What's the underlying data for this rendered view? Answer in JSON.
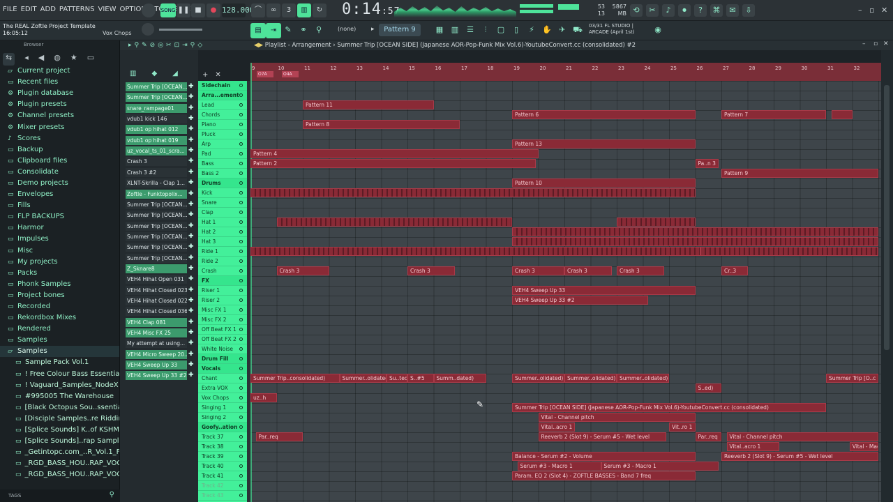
{
  "menu": [
    "FILE",
    "EDIT",
    "ADD",
    "PATTERNS",
    "VIEW",
    "OPTIONS",
    "TOOLS",
    "HELP"
  ],
  "transport": {
    "bpm": "128.000",
    "time_main": "0:14",
    "time_sub": ":57",
    "mode_label": "SONG",
    "cpu": "53",
    "voices": "13",
    "mem": "5867 MB"
  },
  "project": {
    "title": "The REAL Zoftle Project Template",
    "time": "16:05:12",
    "hint": "Vox Chops"
  },
  "toolbar": {
    "snap": "(none)",
    "pattern": "Pattern 9"
  },
  "news": {
    "line1": "03/31  FL STUDIO |",
    "line2": "ARCADE (April 1st)"
  },
  "browser": {
    "label": "Browser",
    "items": [
      {
        "label": "Current project",
        "icon": "folder-open"
      },
      {
        "label": "Recent files",
        "icon": "folder"
      },
      {
        "label": "Plugin database",
        "icon": "plug"
      },
      {
        "label": "Plugin presets",
        "icon": "plug"
      },
      {
        "label": "Channel presets",
        "icon": "plug"
      },
      {
        "label": "Mixer presets",
        "icon": "plug"
      },
      {
        "label": "Scores",
        "icon": "note"
      },
      {
        "label": "Backup",
        "icon": "folder"
      },
      {
        "label": "Clipboard files",
        "icon": "folder"
      },
      {
        "label": "Consolidate",
        "icon": "folder"
      },
      {
        "label": "Demo projects",
        "icon": "folder"
      },
      {
        "label": "Envelopes",
        "icon": "folder"
      },
      {
        "label": "Fills",
        "icon": "folder"
      },
      {
        "label": "FLP BACKUPS",
        "icon": "folder"
      },
      {
        "label": "Harmor",
        "icon": "folder"
      },
      {
        "label": "Impulses",
        "icon": "folder"
      },
      {
        "label": "Misc",
        "icon": "folder"
      },
      {
        "label": "My projects",
        "icon": "folder"
      },
      {
        "label": "Packs",
        "icon": "folder"
      },
      {
        "label": "Phonk Samples",
        "icon": "folder"
      },
      {
        "label": "Project bones",
        "icon": "folder"
      },
      {
        "label": "Recorded",
        "icon": "folder"
      },
      {
        "label": "Rekordbox Mixes",
        "icon": "folder"
      },
      {
        "label": "Rendered",
        "icon": "folder"
      },
      {
        "label": "Samples",
        "icon": "folder"
      },
      {
        "label": "Samples",
        "icon": "folder-open",
        "selected": true
      },
      {
        "label": "Sample Pack Vol.1",
        "icon": "folder",
        "sub": true
      },
      {
        "label": "! Free Colour Bass Essentials !",
        "icon": "folder",
        "sub": true
      },
      {
        "label": "! Vaguard_Samples_NodeX !",
        "icon": "folder",
        "sub": true
      },
      {
        "label": "#995005 The Warehouse",
        "icon": "folder",
        "sub": true
      },
      {
        "label": "[Black Octopus Sou..ssentials Vol. 1",
        "icon": "folder",
        "sub": true
      },
      {
        "label": "[Disciple Samples..re Riddim Vol. 1",
        "icon": "folder",
        "sub": true
      },
      {
        "label": "[Splice Sounds] K..of KSHMR Vol. 3",
        "icon": "folder",
        "sub": true
      },
      {
        "label": "[Splice Sounds]..rap Samples Vol. 1",
        "icon": "folder",
        "sub": true
      },
      {
        "label": "_Getintopc.com_..R_Vol.1_FXB_WAV",
        "icon": "folder",
        "sub": true
      },
      {
        "label": "_RGD_BASS_HOU..RAP_VOCALS_V1",
        "icon": "folder",
        "sub": true
      },
      {
        "label": "_RGD_BASS_HOU..RAP_VOCALS_V2",
        "icon": "folder",
        "sub": true
      }
    ],
    "tags_label": "TAGS"
  },
  "channels": [
    {
      "label": "Summer Trip [OCEAN...",
      "dark": false
    },
    {
      "label": "Summer Trip [OCEAN...",
      "dark": false
    },
    {
      "label": "snare_rampage01",
      "dark": false
    },
    {
      "label": "vdub1 kick 146",
      "dark": true
    },
    {
      "label": "vdub1 op hihat 012",
      "dark": false
    },
    {
      "label": "vdub1 op hihat 019",
      "dark": false
    },
    {
      "label": "uz_vocal_ts_01_scra...",
      "dark": false
    },
    {
      "label": "Crash 3",
      "dark": true
    },
    {
      "label": "Crash 3 #2",
      "dark": true
    },
    {
      "label": "XLNT-Skrilla - Clap 1...",
      "dark": true
    },
    {
      "label": "Zoftle - Funktopolix...",
      "dark": false
    },
    {
      "label": "Summer Trip [OCEAN...",
      "dark": true
    },
    {
      "label": "Summer Trip [OCEAN...",
      "dark": true
    },
    {
      "label": "Summer Trip [OCEAN...",
      "dark": true
    },
    {
      "label": "Summer Trip [OCEAN...",
      "dark": true
    },
    {
      "label": "Summer Trip [OCEAN...",
      "dark": true
    },
    {
      "label": "Summer Trip [OCEAN...",
      "dark": true
    },
    {
      "label": "Z_Sknare8",
      "dark": false
    },
    {
      "label": "VEH4 Hihat Open 031",
      "dark": true
    },
    {
      "label": "VEH4 Hihat Closed 023",
      "dark": true
    },
    {
      "label": "VEH4 Hihat Closed 022",
      "dark": true
    },
    {
      "label": "VEH4 Hihat Closed 036",
      "dark": true
    },
    {
      "label": "VEH4 Clap 081",
      "dark": false
    },
    {
      "label": "VEH4 Misc FX 25",
      "dark": false
    },
    {
      "label": "My attempt at using...",
      "dark": true
    },
    {
      "label": "VEH4 Micro Sweep 20...",
      "dark": false
    },
    {
      "label": "VEH4 Sweep Up 33",
      "dark": false
    },
    {
      "label": "VEH4 Sweep Up 33 #2",
      "dark": false
    }
  ],
  "playlist": {
    "title": "Playlist - Arrangement",
    "song": "Summer Trip [OCEAN SIDE] (Japanese AOR-Pop-Funk Mix Vol.6)-YoutubeConvert.cc (consolidated) #2"
  },
  "ruler": {
    "bars": [
      "9",
      "10",
      "11",
      "12",
      "13",
      "14",
      "15",
      "16",
      "17",
      "18",
      "19",
      "20",
      "21",
      "22",
      "23",
      "24",
      "25",
      "26",
      "27",
      "28",
      "29",
      "30",
      "31",
      "32"
    ],
    "markers": [
      "O7A",
      "O4A"
    ]
  },
  "tracks": [
    {
      "label": "Sidechain",
      "group": true
    },
    {
      "label": "Arra...ement",
      "group": true
    },
    {
      "label": "Lead"
    },
    {
      "label": "Chords"
    },
    {
      "label": "Piano"
    },
    {
      "label": "Pluck"
    },
    {
      "label": "Arp"
    },
    {
      "label": "Pad"
    },
    {
      "label": "Bass"
    },
    {
      "label": "Bass 2"
    },
    {
      "label": "Drums",
      "group": true
    },
    {
      "label": "Kick"
    },
    {
      "label": "Snare"
    },
    {
      "label": "Clap"
    },
    {
      "label": "Hat 1"
    },
    {
      "label": "Hat 2"
    },
    {
      "label": "Hat 3"
    },
    {
      "label": "Ride 1"
    },
    {
      "label": "Ride 2"
    },
    {
      "label": "Crash"
    },
    {
      "label": "FX",
      "group": true
    },
    {
      "label": "Riser 1"
    },
    {
      "label": "Riser 2"
    },
    {
      "label": "Misc FX 1"
    },
    {
      "label": "Misc FX 2"
    },
    {
      "label": "Off Beat FX 1"
    },
    {
      "label": "Off Beat FX 2"
    },
    {
      "label": "White Noise"
    },
    {
      "label": "Drum Fill",
      "group": true
    },
    {
      "label": "Vocals",
      "group": true
    },
    {
      "label": "Chant"
    },
    {
      "label": "Extra VOX"
    },
    {
      "label": "Vox Chops"
    },
    {
      "label": "Singing 1"
    },
    {
      "label": "Singing 2"
    },
    {
      "label": "Goofy..ation",
      "group": true
    },
    {
      "label": "Track 37"
    },
    {
      "label": "Track 38"
    },
    {
      "label": "Track 39"
    },
    {
      "label": "Track 40"
    },
    {
      "label": "Track 41"
    },
    {
      "label": "Track 42",
      "dim": true
    },
    {
      "label": "Track 43",
      "dim": true
    }
  ],
  "clips": [
    {
      "row": 2,
      "start": 11,
      "end": 16,
      "label": "Pattern 11"
    },
    {
      "row": 3,
      "start": 19,
      "end": 26,
      "label": "Pattern 6"
    },
    {
      "row": 3,
      "start": 27,
      "end": 31,
      "label": "Pattern 7"
    },
    {
      "row": 3,
      "start": 31.2,
      "end": 32,
      "label": ""
    },
    {
      "row": 4,
      "start": 11,
      "end": 17,
      "label": "Pattern 8"
    },
    {
      "row": 6,
      "start": 19,
      "end": 26,
      "label": "Pattern 13"
    },
    {
      "row": 7,
      "start": 9,
      "end": 20,
      "label": "Pattern 4"
    },
    {
      "row": 8,
      "start": 9,
      "end": 19.9,
      "label": "Pattern 2"
    },
    {
      "row": 8,
      "start": 26,
      "end": 26.9,
      "label": "Pa..n 3"
    },
    {
      "row": 9,
      "start": 27,
      "end": 33,
      "label": "Pattern 9"
    },
    {
      "row": 10,
      "start": 19,
      "end": 26,
      "label": "Pattern 10"
    },
    {
      "row": 11,
      "start": 9,
      "end": 26,
      "label": "",
      "hatch": true
    },
    {
      "row": 14,
      "start": 10,
      "end": 19,
      "label": "",
      "hatch": true
    },
    {
      "row": 14,
      "start": 23,
      "end": 26,
      "label": "",
      "hatch": true
    },
    {
      "row": 15,
      "start": 19,
      "end": 33,
      "label": "",
      "hatch": true
    },
    {
      "row": 16,
      "start": 19,
      "end": 33,
      "label": "",
      "hatch": true
    },
    {
      "row": 17,
      "start": 9,
      "end": 26.2,
      "label": "",
      "hatch": true
    },
    {
      "row": 17,
      "start": 26.2,
      "end": 33,
      "label": "",
      "hatch": true
    },
    {
      "row": 19,
      "start": 10,
      "end": 12,
      "label": "Crash 3"
    },
    {
      "row": 19,
      "start": 15,
      "end": 16.8,
      "label": "Crash 3"
    },
    {
      "row": 19,
      "start": 19,
      "end": 21,
      "label": "Crash 3"
    },
    {
      "row": 19,
      "start": 21,
      "end": 22.8,
      "label": "Crash 3"
    },
    {
      "row": 19,
      "start": 23,
      "end": 24.8,
      "label": "Crash 3"
    },
    {
      "row": 19,
      "start": 27,
      "end": 28,
      "label": "Cr..3"
    },
    {
      "row": 21,
      "start": 19,
      "end": 26,
      "label": "VEH4 Sweep Up 33"
    },
    {
      "row": 22,
      "start": 19,
      "end": 24.2,
      "label": "VEH4 Sweep Up 33 #2"
    },
    {
      "row": 30,
      "start": 9,
      "end": 12.4,
      "label": "Summer Trip..consolidated)"
    },
    {
      "row": 30,
      "start": 12.4,
      "end": 14.2,
      "label": "Summer..olidated)"
    },
    {
      "row": 30,
      "start": 14.2,
      "end": 15,
      "label": "Su..ted)"
    },
    {
      "row": 30,
      "start": 15,
      "end": 16,
      "label": "S..#5"
    },
    {
      "row": 30,
      "start": 16,
      "end": 18,
      "label": "Summ..dated)"
    },
    {
      "row": 30,
      "start": 19,
      "end": 21,
      "label": "Summer..olidated)"
    },
    {
      "row": 30,
      "start": 21,
      "end": 23,
      "label": "Summer..olidated)"
    },
    {
      "row": 30,
      "start": 23,
      "end": 25,
      "label": "Summer..olidated)"
    },
    {
      "row": 30,
      "start": 31,
      "end": 33,
      "label": "Summer Trip [O..c (consolidated)"
    },
    {
      "row": 31,
      "start": 26,
      "end": 27,
      "label": "S..ed)"
    },
    {
      "row": 32,
      "start": 9,
      "end": 10,
      "label": "uz..h"
    },
    {
      "row": 33,
      "start": 19,
      "end": 31,
      "label": "Summer Trip [OCEAN SIDE] (Japanese AOR-Pop-Funk Mix Vol.6)-YoutubeConvert.cc (consolidated)"
    },
    {
      "row": 34,
      "start": 20,
      "end": 26,
      "label": "Vital - Channel pitch"
    },
    {
      "row": 35,
      "start": 20,
      "end": 21.4,
      "label": "Vital..acro 1"
    },
    {
      "row": 35,
      "start": 25,
      "end": 26,
      "label": "Vit..ro 1"
    },
    {
      "row": 36,
      "start": 9.2,
      "end": 11,
      "label": "Par..req"
    },
    {
      "row": 36,
      "start": 20,
      "end": 24.9,
      "label": "Reeverb 2 (Slot 9) - Serum #5 - Wet level"
    },
    {
      "row": 36,
      "start": 26,
      "end": 27,
      "label": "Par..req"
    },
    {
      "row": 36,
      "start": 27.2,
      "end": 33,
      "label": "Vital - Channel pitch"
    },
    {
      "row": 37,
      "start": 27.2,
      "end": 29.2,
      "label": "Vital..acro 1"
    },
    {
      "row": 37,
      "start": 31.9,
      "end": 33,
      "label": "Vital - Macro 1"
    },
    {
      "row": 38,
      "start": 19,
      "end": 26,
      "label": "Balance - Serum #2 - Volume"
    },
    {
      "row": 38,
      "start": 27,
      "end": 33,
      "label": "Reeverb 2 (Slot 9) - Serum #5 - Wet level"
    },
    {
      "row": 39,
      "start": 19.2,
      "end": 22.4,
      "label": "Serum #3 - Macro 1"
    },
    {
      "row": 39,
      "start": 22.4,
      "end": 26.9,
      "label": "Serum #3 - Macro 1"
    },
    {
      "row": 40,
      "start": 19,
      "end": 26,
      "label": "Param. EQ 2 (Slot 4) - ZOFTLE BASSES - Band 7 freq"
    }
  ]
}
